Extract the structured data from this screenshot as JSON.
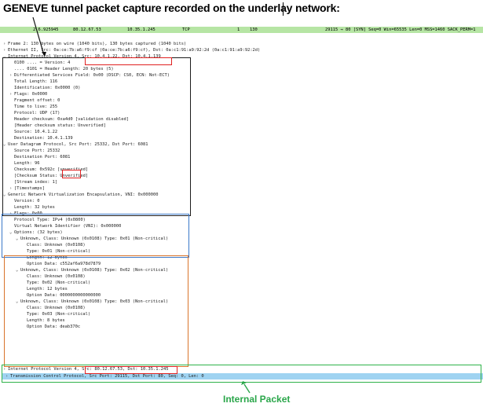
{
  "title": "GENEVE tunnel packet capture recorded on the underlay network:",
  "packet_row": {
    "no": "2 6.925945",
    "src": "80.12.67.53",
    "dst": "10.35.1.245",
    "proto": "TCP",
    "len": "1",
    "len2": "130",
    "info": "29115 → 80 [SYN] Seq=0 Win=65535 Len=0 MSS=1460 SACK_PERM=1"
  },
  "tree": [
    {
      "indent": 0,
      "arrow": ">",
      "text": "Frame 2: 130 bytes on wire (1040 bits), 130 bytes captured (1040 bits)"
    },
    {
      "indent": 0,
      "arrow": ">",
      "text": "Ethernet II, Src: 0a:ce:7b:a6:f9:cf (0a:ce:7b:a6:f9:cf), Dst: 0a:c1:91:a9:92:2d (0a:c1:91:a9:92:2d)"
    },
    {
      "indent": 0,
      "arrow": "v",
      "text": "Internet Protocol Version 4, Src: 10.4.1.22, Dst: 10.4.1.139"
    },
    {
      "indent": 1,
      "arrow": "",
      "text": "0100 .... = Version: 4"
    },
    {
      "indent": 1,
      "arrow": "",
      "text": ".... 0101 = Header Length: 20 bytes (5)"
    },
    {
      "indent": 1,
      "arrow": ">",
      "text": "Differentiated Services Field: 0x00 (DSCP: CS0, ECN: Not-ECT)"
    },
    {
      "indent": 1,
      "arrow": "",
      "text": "Total Length: 116"
    },
    {
      "indent": 1,
      "arrow": "",
      "text": "Identification: 0x0000 (0)"
    },
    {
      "indent": 1,
      "arrow": ">",
      "text": "Flags: 0x0000"
    },
    {
      "indent": 1,
      "arrow": "",
      "text": "Fragment offset: 0"
    },
    {
      "indent": 1,
      "arrow": "",
      "text": "Time to live: 255"
    },
    {
      "indent": 1,
      "arrow": "",
      "text": "Protocol: UDP (17)"
    },
    {
      "indent": 1,
      "arrow": "",
      "text": "Header checksum: 0xa4d0 [validation disabled]"
    },
    {
      "indent": 1,
      "arrow": "",
      "text": "[Header checksum status: Unverified]"
    },
    {
      "indent": 1,
      "arrow": "",
      "text": "Source: 10.4.1.22"
    },
    {
      "indent": 1,
      "arrow": "",
      "text": "Destination: 10.4.1.139"
    },
    {
      "indent": 0,
      "arrow": "v",
      "text": "User Datagram Protocol, Src Port: 25332, Dst Port: 6081"
    },
    {
      "indent": 1,
      "arrow": "",
      "text": "Source Port: 25332"
    },
    {
      "indent": 1,
      "arrow": "",
      "text": "Destination Port: 6081"
    },
    {
      "indent": 1,
      "arrow": "",
      "text": "Length: 96"
    },
    {
      "indent": 1,
      "arrow": "",
      "text": "Checksum: 0x592c [unverified]"
    },
    {
      "indent": 1,
      "arrow": "",
      "text": "[Checksum Status: Unverified]"
    },
    {
      "indent": 1,
      "arrow": "",
      "text": "[Stream index: 1]"
    },
    {
      "indent": 1,
      "arrow": ">",
      "text": "[Timestamps]"
    },
    {
      "indent": 0,
      "arrow": "v",
      "text": "Generic Network Virtualization Encapsulation, VNI: 0x000000"
    },
    {
      "indent": 1,
      "arrow": "",
      "text": "Version: 0"
    },
    {
      "indent": 1,
      "arrow": "",
      "text": "Length: 32 bytes"
    },
    {
      "indent": 1,
      "arrow": ">",
      "text": "Flags: 0x00"
    },
    {
      "indent": 1,
      "arrow": "",
      "text": "Protocol Type: IPv4 (0x0800)"
    },
    {
      "indent": 1,
      "arrow": "",
      "text": "Virtual Network Identifier (VNI): 0x000000"
    },
    {
      "indent": 1,
      "arrow": "v",
      "text": "Options: (32 bytes)"
    },
    {
      "indent": 2,
      "arrow": "v",
      "text": "Unknown, Class: Unknown (0x0108) Type: 0x01 (Non-critical)"
    },
    {
      "indent": 3,
      "arrow": "",
      "text": "Class: Unknown (0x0108)"
    },
    {
      "indent": 3,
      "arrow": "",
      "text": "Type: 0x01 (Non-critical)"
    },
    {
      "indent": 3,
      "arrow": "",
      "text": "Length: 12 bytes"
    },
    {
      "indent": 3,
      "arrow": "",
      "text": "Option Data: c552af6a978d7879"
    },
    {
      "indent": 2,
      "arrow": "v",
      "text": "Unknown, Class: Unknown (0x0108) Type: 0x02 (Non-critical)"
    },
    {
      "indent": 3,
      "arrow": "",
      "text": "Class: Unknown (0x0108)"
    },
    {
      "indent": 3,
      "arrow": "",
      "text": "Type: 0x02 (Non-critical)"
    },
    {
      "indent": 3,
      "arrow": "",
      "text": "Length: 12 bytes"
    },
    {
      "indent": 3,
      "arrow": "",
      "text": "Option Data: 0000000000000000"
    },
    {
      "indent": 2,
      "arrow": "v",
      "text": "Unknown, Class: Unknown (0x0108) Type: 0x03 (Non-critical)"
    },
    {
      "indent": 3,
      "arrow": "",
      "text": "Class: Unknown (0x0108)"
    },
    {
      "indent": 3,
      "arrow": "",
      "text": "Type: 0x03 (Non-critical)"
    },
    {
      "indent": 3,
      "arrow": "",
      "text": "Length: 8 bytes"
    },
    {
      "indent": 3,
      "arrow": "",
      "text": "Option Data: deab370c"
    },
    {
      "indent": 0,
      "arrow": ">",
      "text": "Internet Protocol Version 4, Src: 80.12.67.53, Dst: 10.35.1.245"
    },
    {
      "indent": 0,
      "arrow": ">",
      "text": "Transmission Control Protocol, Src Port: 29115, Dst Port: 80, Seq: 0, Len: 0"
    }
  ],
  "bottom_label": "Internal Packet",
  "colors": {
    "packet_row_bg": "#b6e5a4",
    "selected_row_bg": "#9fd3f1",
    "black_box": "#1c1c1c",
    "blue_box": "#3b78c9",
    "orange_box": "#d9742b",
    "green_box": "#2fb34a",
    "red_box": "#e02020",
    "label_green": "#2aa64a"
  }
}
